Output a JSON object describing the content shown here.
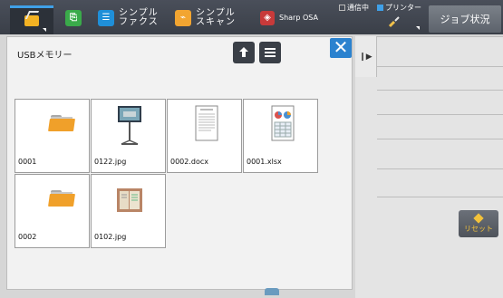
{
  "topbar": {
    "items": [
      {
        "label_top": "",
        "label_bottom": "",
        "name": "home"
      },
      {
        "label_top": "",
        "label_bottom": "",
        "name": "copy"
      },
      {
        "label_top": "シンプル",
        "label_bottom": "ファクス",
        "name": "simple-fax"
      },
      {
        "label_top": "シンプル",
        "label_bottom": "スキャン",
        "name": "simple-scan"
      },
      {
        "label": "Sharp OSA",
        "name": "sharp-osa"
      }
    ],
    "status_comm": "通信中",
    "status_printer": "プリンター",
    "job_status": "ジョブ状況"
  },
  "panel": {
    "title": "USBメモリー",
    "files": [
      {
        "name": "0001",
        "type": "folder"
      },
      {
        "name": "0122.jpg",
        "type": "image"
      },
      {
        "name": "0002.docx",
        "type": "doc"
      },
      {
        "name": "0001.xlsx",
        "type": "sheet"
      },
      {
        "name": "0002",
        "type": "folder"
      },
      {
        "name": "0102.jpg",
        "type": "image"
      }
    ]
  },
  "side": {
    "reset_label": "リセット"
  },
  "colors": {
    "accent": "#2b82cf",
    "folder": "#f0a02a",
    "topbar": "#3f444d"
  }
}
